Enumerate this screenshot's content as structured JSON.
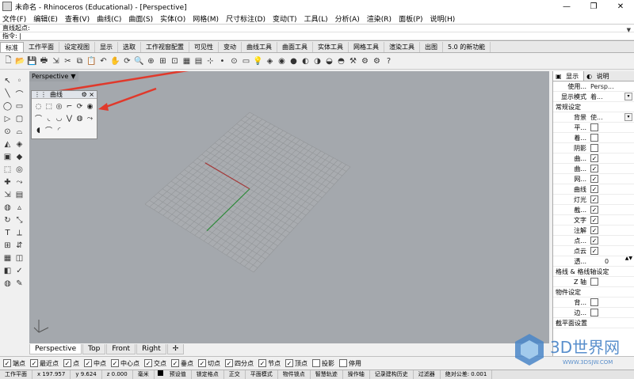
{
  "window": {
    "title": "未命名 - Rhinoceros (Educational) - [Perspective]",
    "buttons": [
      "—",
      "❐",
      "✕"
    ]
  },
  "menubar": [
    "文件(F)",
    "编辑(E)",
    "查看(V)",
    "曲线(C)",
    "曲面(S)",
    "实体(O)",
    "网格(M)",
    "尺寸标注(D)",
    "变动(T)",
    "工具(L)",
    "分析(A)",
    "渲染(R)",
    "面板(P)",
    "说明(H)"
  ],
  "command": {
    "history": "直线起点:",
    "prompt": "指令: |",
    "arrow": "▼"
  },
  "tabs": [
    "标准",
    "工作平面",
    "设定视图",
    "显示",
    "选取",
    "工作视窗配置",
    "可见性",
    "变动",
    "曲线工具",
    "曲面工具",
    "实体工具",
    "网格工具",
    "渲染工具",
    "出图",
    "5.0 的新功能"
  ],
  "toolbar_icons": [
    "new-icon",
    "open-icon",
    "save-icon",
    "print-icon",
    "import-icon",
    "cut-icon",
    "copy-icon",
    "paste-icon",
    "undo-icon",
    "pan-icon",
    "rotate-view-icon",
    "zoom-icon",
    "zoom-window-icon",
    "zoom-extents-icon",
    "zoom-selected-icon",
    "viewports-icon",
    "grid-icon",
    "snap-icon",
    "point-icon",
    "select-icon",
    "layer-icon",
    "light-icon",
    "material-icon",
    "color-icon",
    "render-icon",
    "shade-icon",
    "ghost-icon",
    "xray-icon",
    "sphere-icon",
    "hammer-icon",
    "options-icon",
    "gear-icon",
    "help-icon"
  ],
  "toolbar_glyphs": [
    "🗋",
    "📂",
    "💾",
    "🖶",
    "⇲",
    "✂",
    "⧉",
    "📋",
    "↶",
    "✋",
    "⟳",
    "🔍",
    "⊕",
    "⊞",
    "⊡",
    "▦",
    "▤",
    "⊹",
    "•",
    "⊙",
    "▭",
    "💡",
    "◈",
    "◉",
    "●",
    "◐",
    "◑",
    "◒",
    "◓",
    "⚒",
    "⚙",
    "⚙",
    "?"
  ],
  "left_icons": [
    "↖",
    "◦",
    "╲",
    "⌒",
    "◯",
    "▭",
    "▷",
    "▢",
    "⊙",
    "⌓",
    "◭",
    "◈",
    "▣",
    "◆",
    "⬚",
    "◎",
    "✚",
    "⤳",
    "⇲",
    "▤",
    "◍",
    "▵",
    "↻",
    "⤡",
    "T",
    "⟂",
    "⊞",
    "⇵",
    "▦",
    "◫",
    "◧",
    "✓",
    "◍",
    "✎"
  ],
  "viewport": {
    "name": "Perspective",
    "menu_arrow": "▼",
    "grid": {
      "x_axis_color": "#a33a3a",
      "y_axis_color": "#2e8a3a",
      "line_color": "#939699",
      "bg_color": "#a4a8ad"
    }
  },
  "curve_panel": {
    "title": "曲线",
    "settings": "⚙",
    "close": "×",
    "icons": [
      "◌",
      "⬚",
      "◎",
      "⌐",
      "⟳",
      "◉",
      "⌒",
      "◟",
      "◡",
      "⋁",
      "◍",
      "⤳",
      "◖",
      "⌒",
      "◜"
    ]
  },
  "view_tabs": [
    "Perspective",
    "Top",
    "Front",
    "Right",
    "✢"
  ],
  "right_panel": {
    "tabs": [
      "显示",
      "说明"
    ],
    "rows": [
      {
        "label": "使用...",
        "value": "Persp...",
        "kind": "text"
      },
      {
        "label": "显示模式",
        "value": "着...",
        "kind": "dropdown"
      },
      {
        "section": "常规设定"
      },
      {
        "label": "背景",
        "value": "使...",
        "kind": "dropdown"
      },
      {
        "label": "平...",
        "checked": false,
        "kind": "check"
      },
      {
        "label": "着...",
        "checked": false,
        "kind": "check"
      },
      {
        "label": "阴影",
        "checked": false,
        "kind": "check"
      },
      {
        "label": "曲...",
        "checked": true,
        "kind": "check"
      },
      {
        "label": "曲...",
        "checked": true,
        "kind": "check"
      },
      {
        "label": "网...",
        "checked": true,
        "kind": "check"
      },
      {
        "label": "曲线",
        "checked": true,
        "kind": "check"
      },
      {
        "label": "灯光",
        "checked": true,
        "kind": "check"
      },
      {
        "label": "截...",
        "checked": true,
        "kind": "check"
      },
      {
        "label": "文字",
        "checked": true,
        "kind": "check"
      },
      {
        "label": "注解",
        "checked": true,
        "kind": "check"
      },
      {
        "label": "点...",
        "checked": true,
        "kind": "check"
      },
      {
        "label": "点云",
        "checked": true,
        "kind": "check"
      },
      {
        "label": "透...",
        "value": "0",
        "kind": "spin"
      },
      {
        "section": "格线 & 格线轴设定"
      },
      {
        "label": "Z 轴",
        "checked": false,
        "kind": "check"
      },
      {
        "section": "物件设定"
      },
      {
        "label": "背...",
        "checked": false,
        "kind": "check"
      },
      {
        "label": "边...",
        "checked": false,
        "kind": "check"
      },
      {
        "section": "截平面设置"
      }
    ],
    "check_mark": "✓",
    "dropdown_arrow": "▾",
    "spin_arrows": "▲▼"
  },
  "snaps": [
    {
      "label": "端点",
      "checked": true
    },
    {
      "label": "最近点",
      "checked": true
    },
    {
      "label": "点",
      "checked": true
    },
    {
      "label": "中点",
      "checked": true
    },
    {
      "label": "中心点",
      "checked": true
    },
    {
      "label": "交点",
      "checked": true
    },
    {
      "label": "垂点",
      "checked": true
    },
    {
      "label": "切点",
      "checked": true
    },
    {
      "label": "四分点",
      "checked": true
    },
    {
      "label": "节点",
      "checked": true
    },
    {
      "label": "顶点",
      "checked": true
    },
    {
      "label": "投影",
      "checked": false
    },
    {
      "label": "停用",
      "checked": false
    }
  ],
  "status": {
    "plane": "工作平面",
    "x": "x 197.957",
    "y": "y 9.624",
    "z": "z 0.000",
    "unit": "毫米",
    "layer": "预设值",
    "items": [
      "锁定格点",
      "正交",
      "平面模式",
      "物件锁点",
      "智慧轨迹",
      "操作轴",
      "记录建构历史",
      "过滤器",
      "绝对公差: 0.001"
    ]
  }
}
